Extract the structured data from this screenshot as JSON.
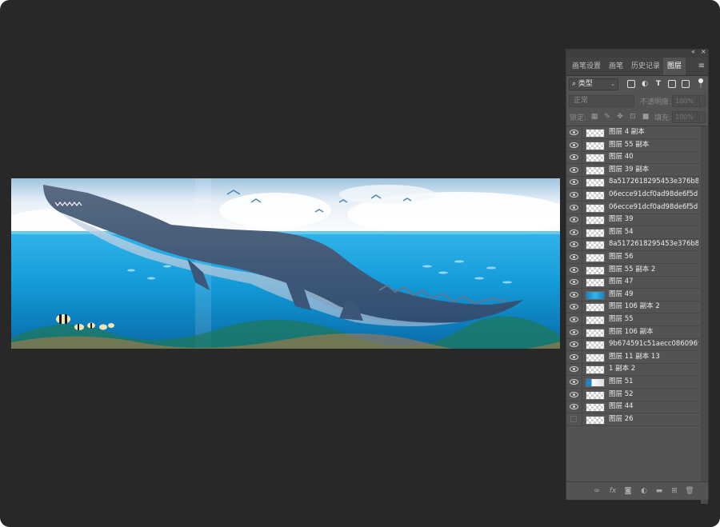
{
  "panel": {
    "collapse_icon": "double-chevron-icon",
    "close_icon": "close-icon",
    "tabs": [
      {
        "label": "画笔设置",
        "active": false
      },
      {
        "label": "画笔",
        "active": false
      },
      {
        "label": "历史记录",
        "active": false
      },
      {
        "label": "图层",
        "active": true
      }
    ],
    "menu_icon": "hamburger-menu-icon"
  },
  "filter": {
    "kind_label": "类型",
    "kind_icon": "search-icon",
    "filter_icons": [
      "image-filter-icon",
      "adjustment-filter-icon",
      "text-filter-icon",
      "shape-filter-icon",
      "smart-object-filter-icon"
    ]
  },
  "blend": {
    "mode": "正常",
    "opacity_label": "不透明度:",
    "opacity_value": "100%"
  },
  "lock": {
    "label": "锁定:",
    "icons": [
      "lock-transparent-icon",
      "lock-brush-icon",
      "lock-move-icon",
      "lock-artboard-icon",
      "lock-all-icon"
    ],
    "fill_label": "填充:",
    "fill_value": "100%"
  },
  "layers": [
    {
      "name": "图层 4 副本",
      "visible": true,
      "thumb": "checker"
    },
    {
      "name": "图层 55 副本",
      "visible": true,
      "thumb": "checker"
    },
    {
      "name": "图层 40",
      "visible": true,
      "thumb": "checker"
    },
    {
      "name": "图层 39 副本",
      "visible": true,
      "thumb": "checker"
    },
    {
      "name": "8a5172618295453e376b8f...",
      "visible": true,
      "thumb": "checker"
    },
    {
      "name": "06ecce91dcf0ad98de6f5d1...",
      "visible": true,
      "thumb": "checker"
    },
    {
      "name": "06ecce91dcf0ad98de6f5d1...",
      "visible": true,
      "thumb": "checker"
    },
    {
      "name": "图层 39",
      "visible": true,
      "thumb": "checker"
    },
    {
      "name": "图层 54",
      "visible": true,
      "thumb": "checker"
    },
    {
      "name": "8a5172618295453e376b8f...",
      "visible": true,
      "thumb": "checker"
    },
    {
      "name": "图层 56",
      "visible": true,
      "thumb": "checker"
    },
    {
      "name": "图层 55 副本 2",
      "visible": true,
      "thumb": "checker"
    },
    {
      "name": "图层 47",
      "visible": true,
      "thumb": "checker"
    },
    {
      "name": "图层 49",
      "visible": true,
      "thumb": "blue"
    },
    {
      "name": "图层 106 副本 2",
      "visible": true,
      "thumb": "checker"
    },
    {
      "name": "图层 55",
      "visible": true,
      "thumb": "checker"
    },
    {
      "name": "图层 106 副本",
      "visible": true,
      "thumb": "checker"
    },
    {
      "name": "9b674591c51aecc0860969...",
      "visible": true,
      "thumb": "checker"
    },
    {
      "name": "图层 11 副本 13",
      "visible": true,
      "thumb": "checker"
    },
    {
      "name": "1 副本 2",
      "visible": true,
      "thumb": "checker"
    },
    {
      "name": "图层 51",
      "visible": true,
      "thumb": "mixed"
    },
    {
      "name": "图层 52",
      "visible": true,
      "thumb": "checker"
    },
    {
      "name": "图层 44",
      "visible": true,
      "thumb": "checker"
    },
    {
      "name": "图层 26",
      "visible": false,
      "thumb": "checker"
    }
  ],
  "bottom_icons": [
    "link-layers-icon",
    "fx-icon",
    "add-mask-icon",
    "adjustment-layer-icon",
    "new-group-icon",
    "new-layer-icon",
    "delete-icon"
  ],
  "colors": {
    "workspace": "#282828",
    "panel": "#535353",
    "sea_top": "#1ea3e0",
    "sea_bottom": "#0b6fb0",
    "sky": "#e8f1f8"
  }
}
